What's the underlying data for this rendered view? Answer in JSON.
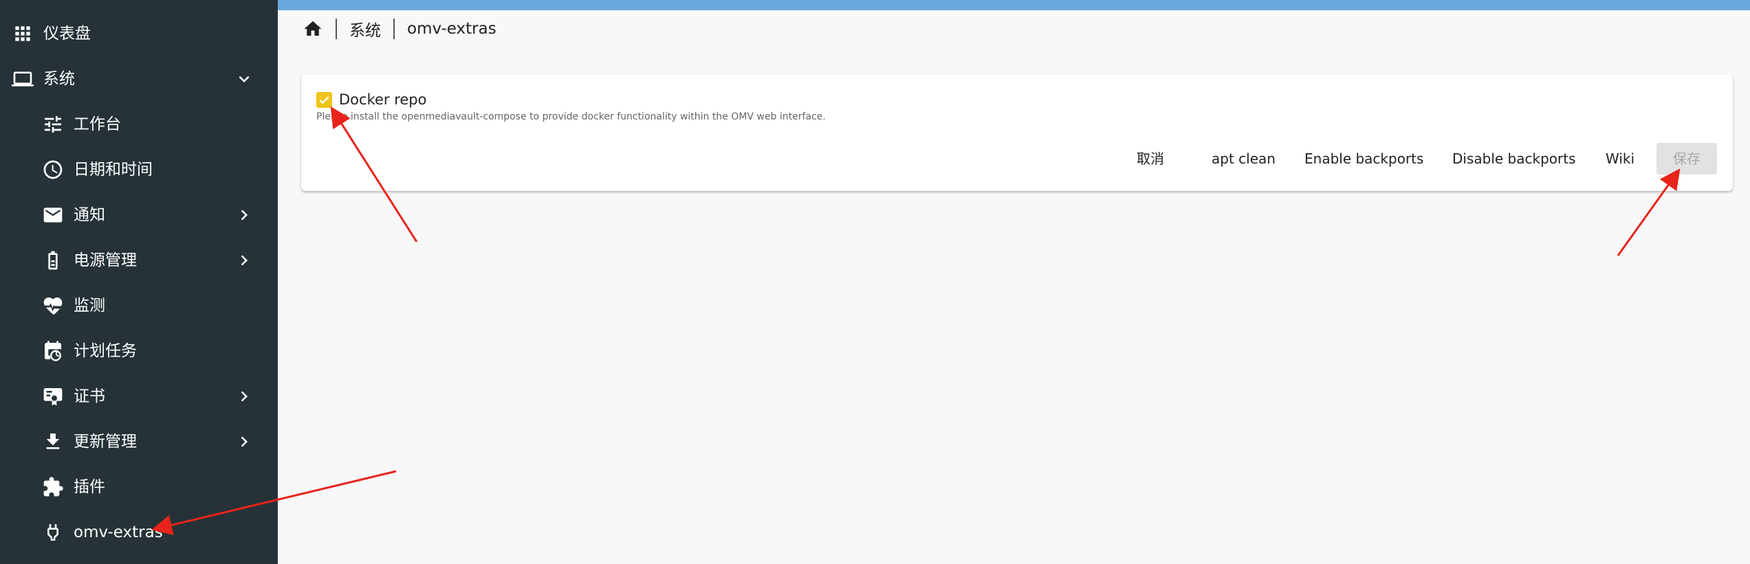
{
  "sidebar": {
    "items": [
      {
        "label": "仪表盘",
        "icon": "grid-icon"
      },
      {
        "label": "系统",
        "icon": "laptop-icon"
      },
      {
        "label": "工作台",
        "icon": "sliders-icon"
      },
      {
        "label": "日期和时间",
        "icon": "clock-icon"
      },
      {
        "label": "通知",
        "icon": "mail-icon"
      },
      {
        "label": "电源管理",
        "icon": "battery-icon"
      },
      {
        "label": "监测",
        "icon": "heart-pulse-icon"
      },
      {
        "label": "计划任务",
        "icon": "calendar-clock-icon"
      },
      {
        "label": "证书",
        "icon": "certificate-icon"
      },
      {
        "label": "更新管理",
        "icon": "download-icon"
      },
      {
        "label": "插件",
        "icon": "puzzle-icon"
      },
      {
        "label": "omv-extras",
        "icon": "plug-icon"
      }
    ]
  },
  "breadcrumb": {
    "home_icon": "home-icon",
    "items": [
      "系统",
      "omv-extras"
    ]
  },
  "card": {
    "checkbox_label": "Docker repo",
    "checkbox_checked": true,
    "hint": "Please install the openmediavault-compose to provide docker functionality within the OMV web interface.",
    "buttons": {
      "cancel": "取消",
      "apt_clean": "apt clean",
      "enable_backports": "Enable backports",
      "disable_backports": "Disable backports",
      "wiki": "Wiki",
      "save": "保存"
    }
  },
  "colors": {
    "sidebar_bg": "#263238",
    "topbar": "#6aa9dd",
    "checkbox": "#f0c41b",
    "annotation_arrow": "#e8241c"
  }
}
